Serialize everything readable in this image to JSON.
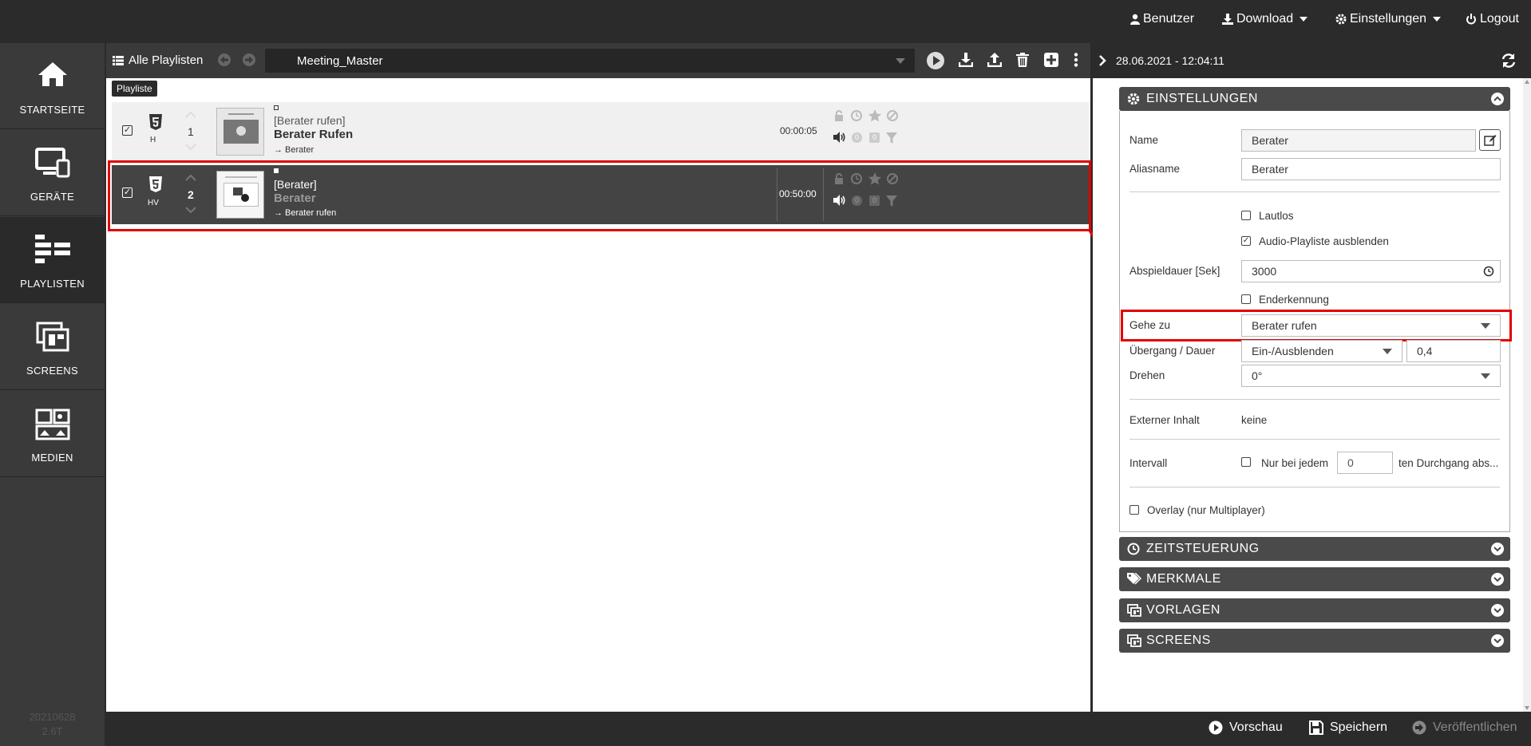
{
  "topbar": {
    "user": "Benutzer",
    "download": "Download",
    "settings": "Einstellungen",
    "logout": "Logout"
  },
  "sidebar": {
    "items": [
      {
        "label": "STARTSEITE",
        "icon": "home-icon"
      },
      {
        "label": "GERÄTE",
        "icon": "devices-icon"
      },
      {
        "label": "PLAYLISTEN",
        "icon": "playlist-icon"
      },
      {
        "label": "SCREENS",
        "icon": "screens-icon"
      },
      {
        "label": "MEDIEN",
        "icon": "media-icon"
      }
    ],
    "version_line1": "20210628",
    "version_line2": "2.6T"
  },
  "toolbar": {
    "all_playlists": "Alle Playlisten",
    "playlist_name": "Meeting_Master",
    "tooltip": "Playliste"
  },
  "rows": [
    {
      "number": "1",
      "type_label": "H",
      "bracket_title": "[Berater rufen]",
      "title": "Berater Rufen",
      "goto": "→ Berater",
      "duration": "00:00:05",
      "badge_a": "0",
      "badge_b": "0"
    },
    {
      "number": "2",
      "type_label": "HV",
      "bracket_title": "[Berater]",
      "title": "Berater",
      "goto": "→ Berater rufen",
      "duration": "00:50:00",
      "badge_a": "0",
      "badge_b": "0"
    }
  ],
  "right_panel": {
    "datetime": "28.06.2021 - 12:04:11",
    "settings_title": "EINSTELLUNGEN",
    "fields": {
      "name_label": "Name",
      "name_value": "Berater",
      "alias_label": "Aliasname",
      "alias_value": "Berater",
      "mute_label": "Lautlos",
      "hide_audio_label": "Audio-Playliste ausblenden",
      "duration_label": "Abspieldauer [Sek]",
      "duration_value": "3000",
      "end_mark_label": "Enderkennung",
      "goto_label": "Gehe zu",
      "goto_value": "Berater rufen",
      "transition_label": "Übergang / Dauer",
      "transition_value": "Ein-/Ausblenden",
      "transition_duration": "0,4",
      "rotate_label": "Drehen",
      "rotate_value": "0°",
      "external_label": "Externer Inhalt",
      "external_value": "keine",
      "interval_label": "Intervall",
      "interval_prefix": "Nur bei jedem",
      "interval_value": "0",
      "interval_suffix": "ten Durchgang abs...",
      "overlay_label": "Overlay (nur Multiplayer)"
    },
    "sections": [
      {
        "title": "ZEITSTEUERUNG",
        "icon": "clock-icon"
      },
      {
        "title": "MERKMALE",
        "icon": "tags-icon"
      },
      {
        "title": "VORLAGEN",
        "icon": "template-icon"
      },
      {
        "title": "SCREENS",
        "icon": "screens-icon"
      }
    ]
  },
  "bottombar": {
    "preview": "Vorschau",
    "save": "Speichern",
    "publish": "Veröffentlichen"
  },
  "colors": {
    "highlight": "#e00000",
    "dark": "#2b2b2b",
    "sidebar": "#3a3a3a",
    "selected_row": "#444444"
  }
}
